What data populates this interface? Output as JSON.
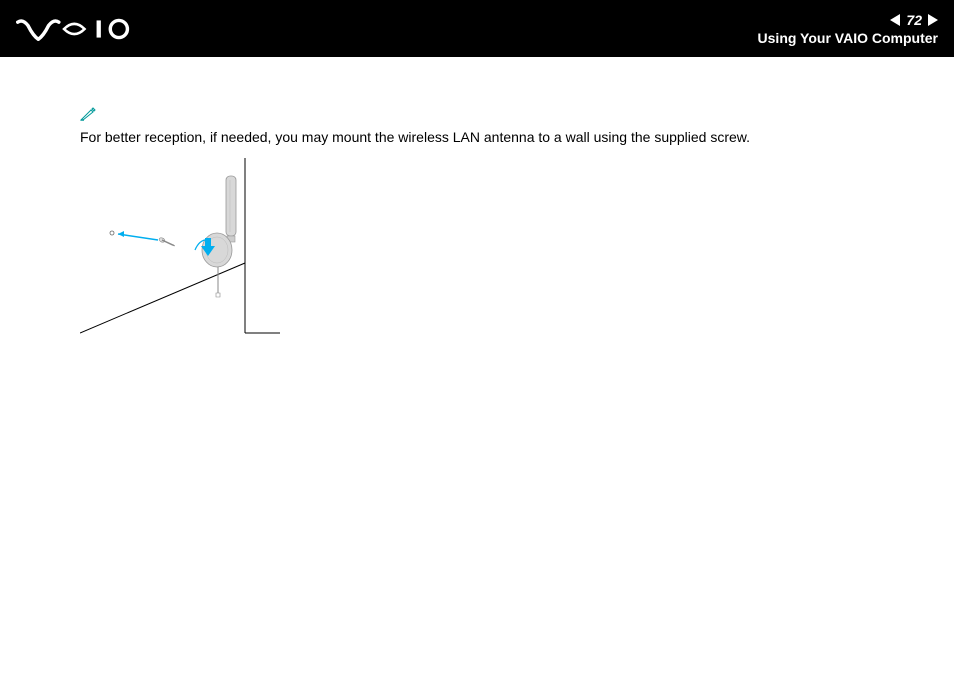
{
  "header": {
    "logo_text": "VAIO",
    "page_number": "72",
    "section_title": "Using Your VAIO Computer"
  },
  "content": {
    "note_text": "For better reception, if needed, you may mount the wireless LAN antenna to a wall using the supplied screw."
  }
}
